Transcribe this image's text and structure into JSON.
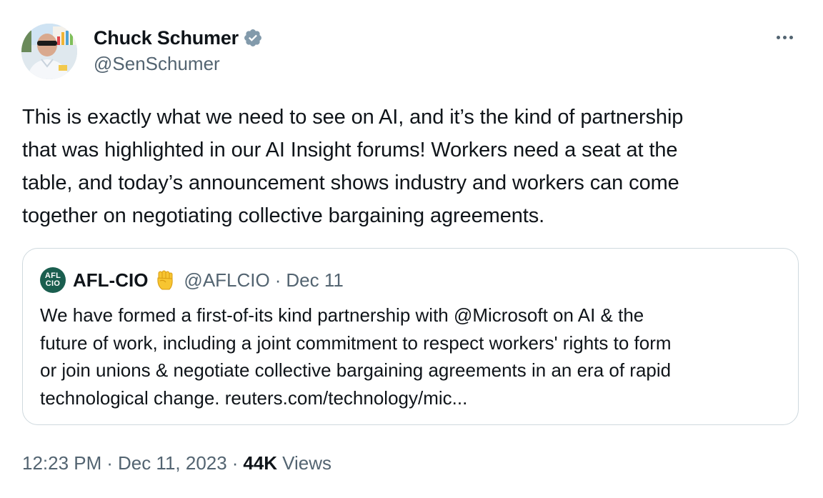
{
  "author": {
    "display_name": "Chuck Schumer",
    "handle": "@SenSchumer",
    "verified_icon": "verified-badge-icon",
    "verified_color": "#829aab"
  },
  "more_icon": "more-horizontal-icon",
  "tweet": {
    "text": "This is exactly what we need to see on AI, and it’s the kind of partnership\nthat was highlighted in our AI Insight forums! Workers need a seat at the\ntable, and today’s announcement shows industry and workers can come\ntogether on negotiating collective bargaining agreements."
  },
  "quote": {
    "avatar_top": "AFL",
    "avatar_bottom": "CIO",
    "avatar_color": "#1a5e4f",
    "name": "AFL-CIO",
    "name_icon": "raised-fist-icon",
    "handle": "@AFLCIO",
    "separator": "·",
    "date": "Dec 11",
    "text": "We have formed a first-of-its kind partnership with @Microsoft on AI & the\nfuture of work, including a joint commitment to respect workers' rights to form\nor join unions & negotiate collective bargaining agreements in an era of rapid\ntechnological change. reuters.com/technology/mic..."
  },
  "meta": {
    "time": "12:23 PM",
    "separator": "·",
    "date": "Dec 11, 2023",
    "views_count": "44K",
    "views_label": "Views"
  },
  "colors": {
    "text_primary": "#0f1419",
    "text_secondary": "#536471",
    "border": "#cfd9de"
  }
}
